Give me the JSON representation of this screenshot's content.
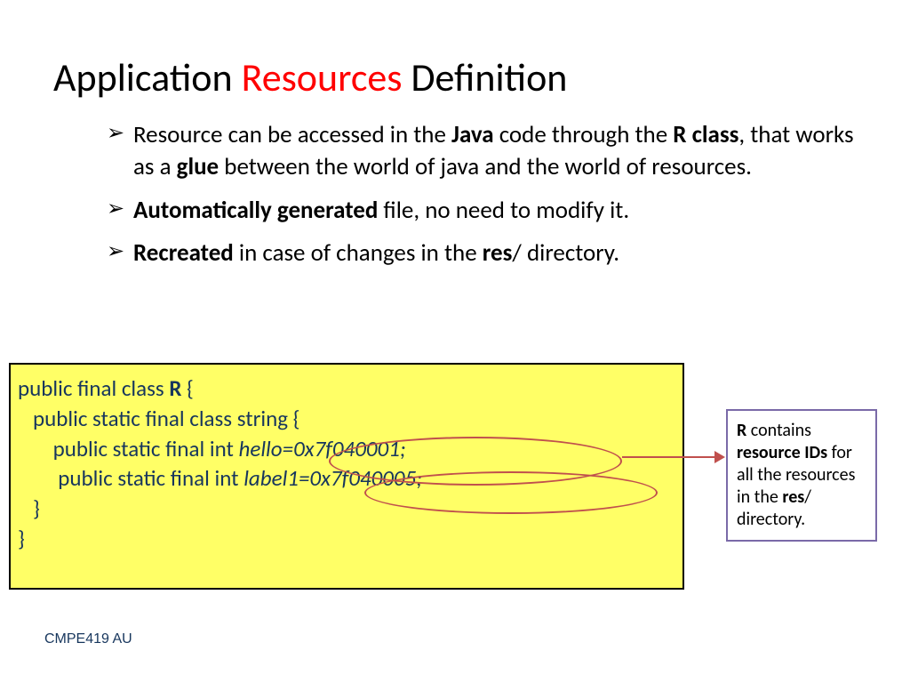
{
  "title": {
    "part1": "Application ",
    "part2": "Resources",
    "part3": " Definition"
  },
  "bullets": [
    {
      "prefix": "Resource can be accessed in the ",
      "b1": "Java",
      "mid1": " code through the ",
      "b2": "R class",
      "mid2": ", that works as a ",
      "b3": "glue",
      "suffix": " between the world of java and the world of resources."
    },
    {
      "b1": "Automatically generated",
      "suffix": " file, no need to modify  it."
    },
    {
      "b1": "Recreated",
      "mid1": " in case of changes in the ",
      "b2": "res",
      "suffix": "/ directory."
    }
  ],
  "code": {
    "l1a": "public final class ",
    "l1b": "R",
    "l1c": " {",
    "l2": "   public static final class string {",
    "l3a": "       public static final int ",
    "l3b": "hello=0x7f040001;",
    "l4a": "        public static final int ",
    "l4b": "label1=0x7f040005;",
    "l5": "   }",
    "l6": "}"
  },
  "note": {
    "b1": "R",
    "t1": " contains ",
    "b2": "resource IDs",
    "t2": " for all the resources in the ",
    "b3": "res",
    "t3": "/ directory."
  },
  "footer": "CMPE419 AU"
}
